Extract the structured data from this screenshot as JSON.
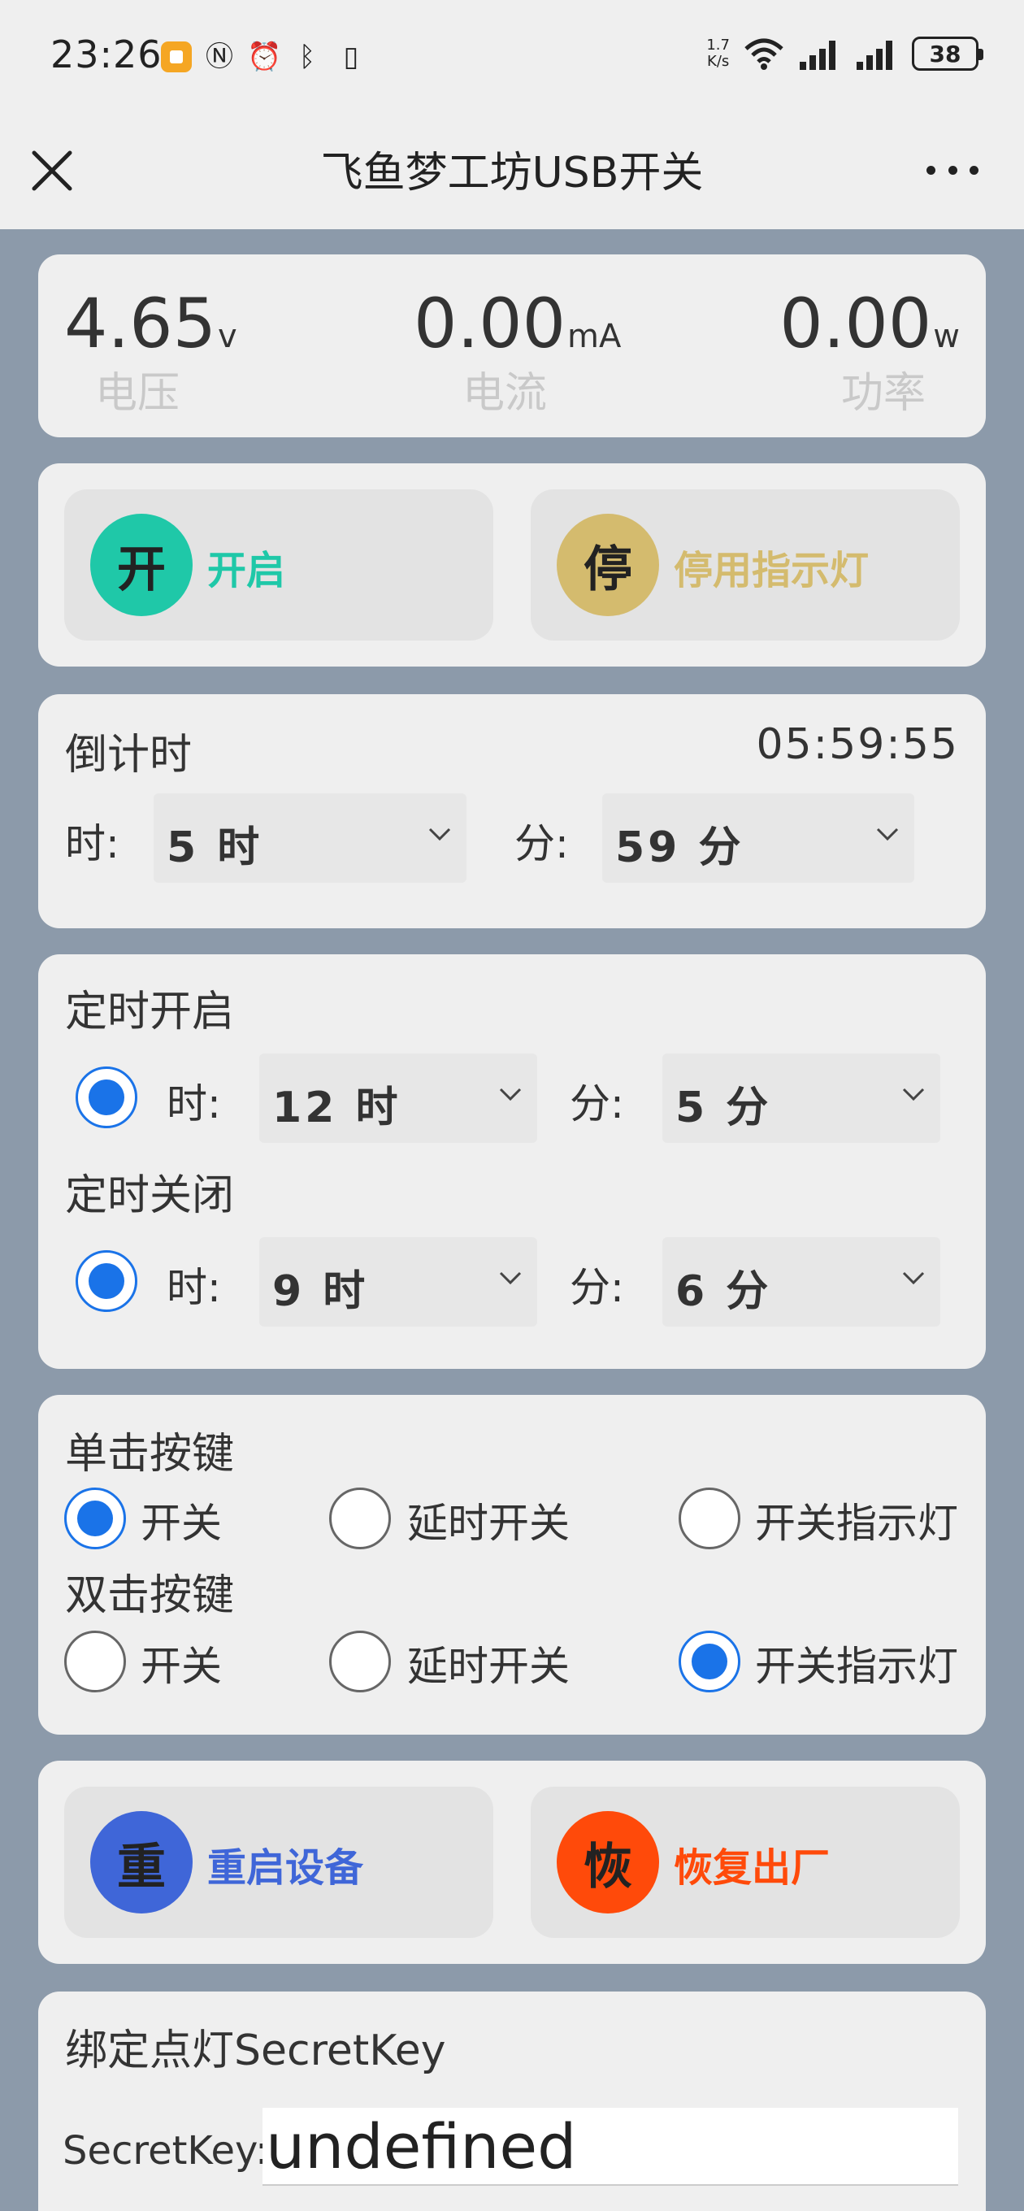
{
  "status_bar": {
    "time": "23:26",
    "speed_top": "1.7",
    "speed_bottom": "K/s",
    "battery": "38",
    "icons": [
      "app-notification-icon",
      "nfc-icon",
      "alarm-icon",
      "bluetooth-icon",
      "vibrate-icon",
      "wifi-icon",
      "signal-icon",
      "signal-icon",
      "battery-icon"
    ]
  },
  "navbar": {
    "title": "飞鱼梦工坊USB开关"
  },
  "stats": {
    "voltage": {
      "value": "4.65",
      "unit": "v",
      "label": "电压"
    },
    "current": {
      "value": "0.00",
      "unit": "mA",
      "label": "电流"
    },
    "power": {
      "value": "0.00",
      "unit": "w",
      "label": "功率"
    }
  },
  "controls": {
    "power": {
      "glyph": "开",
      "label": "开启",
      "color": "#1fc8a8"
    },
    "indicator": {
      "glyph": "停",
      "label": "停用指示灯",
      "color": "#d4bb6e"
    }
  },
  "countdown": {
    "title": "倒计时",
    "remaining": "05:59:55",
    "hour_label": "时:",
    "hour_value": "5 时",
    "minute_label": "分:",
    "minute_value": "59 分"
  },
  "schedule": {
    "on_title": "定时开启",
    "on": {
      "hour_label": "时:",
      "hour_value": "12 时",
      "minute_label": "分:",
      "minute_value": "5 分"
    },
    "off_title": "定时关闭",
    "off": {
      "hour_label": "时:",
      "hour_value": "9 时",
      "minute_label": "分:",
      "minute_value": "6 分"
    }
  },
  "button_mode": {
    "single_title": "单击按键",
    "single_options": [
      "开关",
      "延时开关",
      "开关指示灯"
    ],
    "single_selected": "开关",
    "double_title": "双击按键",
    "double_options": [
      "开关",
      "延时开关",
      "开关指示灯"
    ],
    "double_selected": "开关指示灯"
  },
  "device": {
    "restart": {
      "glyph": "重",
      "label": "重启设备",
      "color": "#3f66d8"
    },
    "reset": {
      "glyph": "恢",
      "label": "恢复出厂",
      "color": "#ff4a0a"
    }
  },
  "secret": {
    "title": "绑定点灯SecretKey",
    "label": "SecretKey:",
    "value": "undefined"
  }
}
